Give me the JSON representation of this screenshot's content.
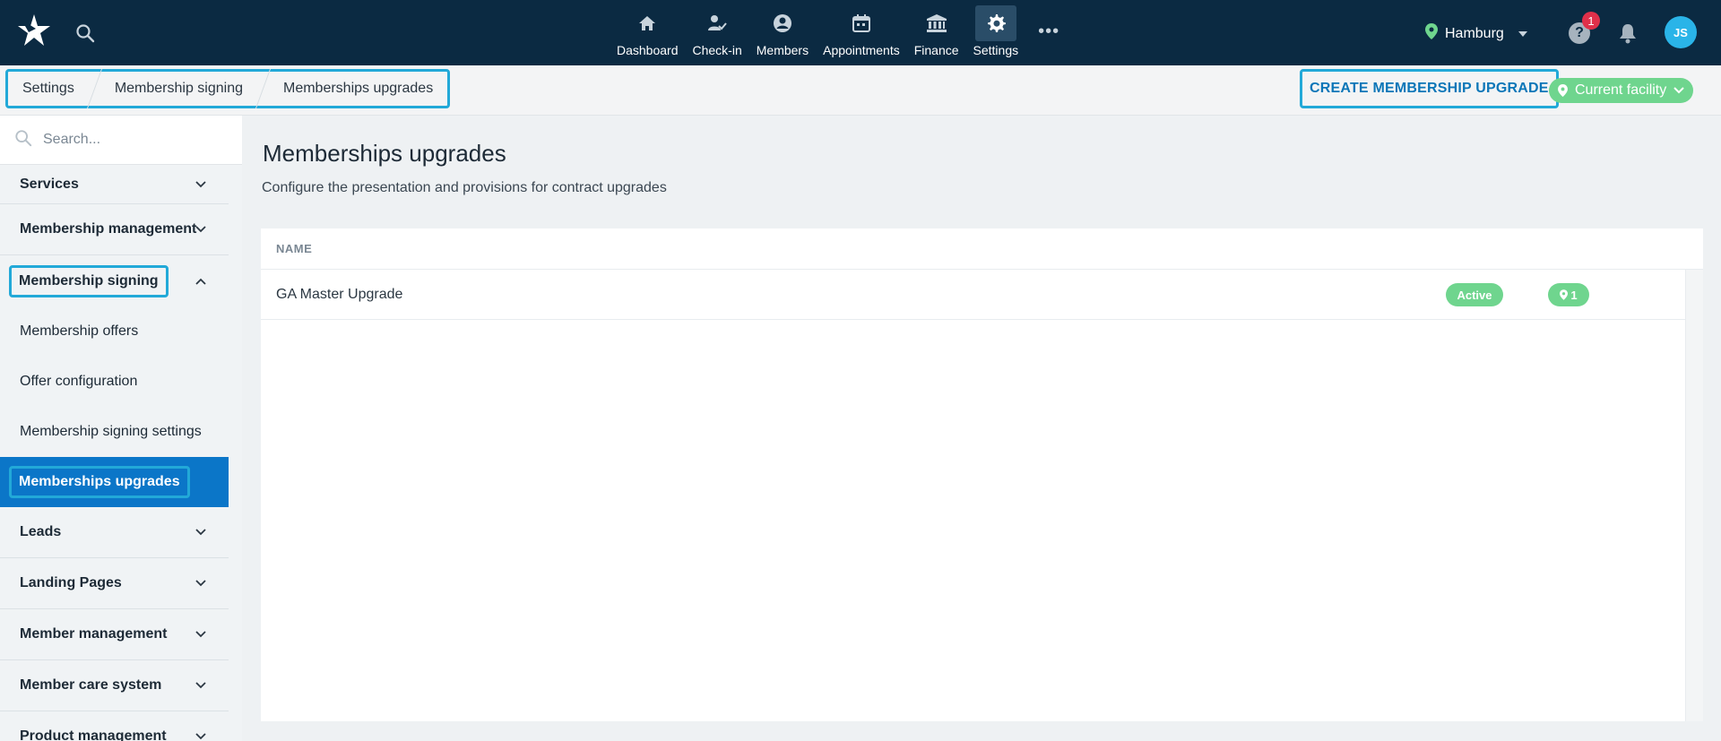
{
  "topnav": {
    "items": [
      {
        "label": "Dashboard",
        "icon": "home-icon"
      },
      {
        "label": "Check-in",
        "icon": "check-in-icon"
      },
      {
        "label": "Members",
        "icon": "member-icon"
      },
      {
        "label": "Appointments",
        "icon": "calendar-icon"
      },
      {
        "label": "Finance",
        "icon": "bank-icon"
      },
      {
        "label": "Settings",
        "icon": "gear-icon",
        "active": true
      }
    ],
    "more": "•••",
    "location": "Hamburg",
    "notification_count": "1",
    "avatar_initials": "JS"
  },
  "breadcrumb": [
    "Settings",
    "Membership signing",
    "Memberships upgrades"
  ],
  "actions": {
    "create": "CREATE MEMBERSHIP UPGRADE",
    "facility": "Current facility"
  },
  "sidebar": {
    "search_placeholder": "Search...",
    "items": [
      {
        "label": "Services",
        "type": "group"
      },
      {
        "label": "Membership management",
        "type": "group"
      },
      {
        "label": "Membership signing",
        "type": "group",
        "expanded": true
      },
      {
        "label": "Membership offers",
        "type": "sub"
      },
      {
        "label": "Offer configuration",
        "type": "sub"
      },
      {
        "label": "Membership signing settings",
        "type": "sub"
      },
      {
        "label": "Memberships upgrades",
        "type": "sub",
        "active": true
      },
      {
        "label": "Leads",
        "type": "group"
      },
      {
        "label": "Landing Pages",
        "type": "group"
      },
      {
        "label": "Member management",
        "type": "group"
      },
      {
        "label": "Member care system",
        "type": "group"
      },
      {
        "label": "Product management",
        "type": "group"
      }
    ]
  },
  "main": {
    "title": "Memberships upgrades",
    "description": "Configure the presentation and provisions for contract upgrades",
    "table": {
      "header": "NAME",
      "rows": [
        {
          "name": "GA Master Upgrade",
          "status": "Active",
          "locations": "1"
        }
      ]
    }
  },
  "colors": {
    "topbar": "#0b2a42",
    "accent": "#0b76c8",
    "highlight": "#22a9d8",
    "success": "#6fd58e",
    "alert": "#e0304a"
  }
}
